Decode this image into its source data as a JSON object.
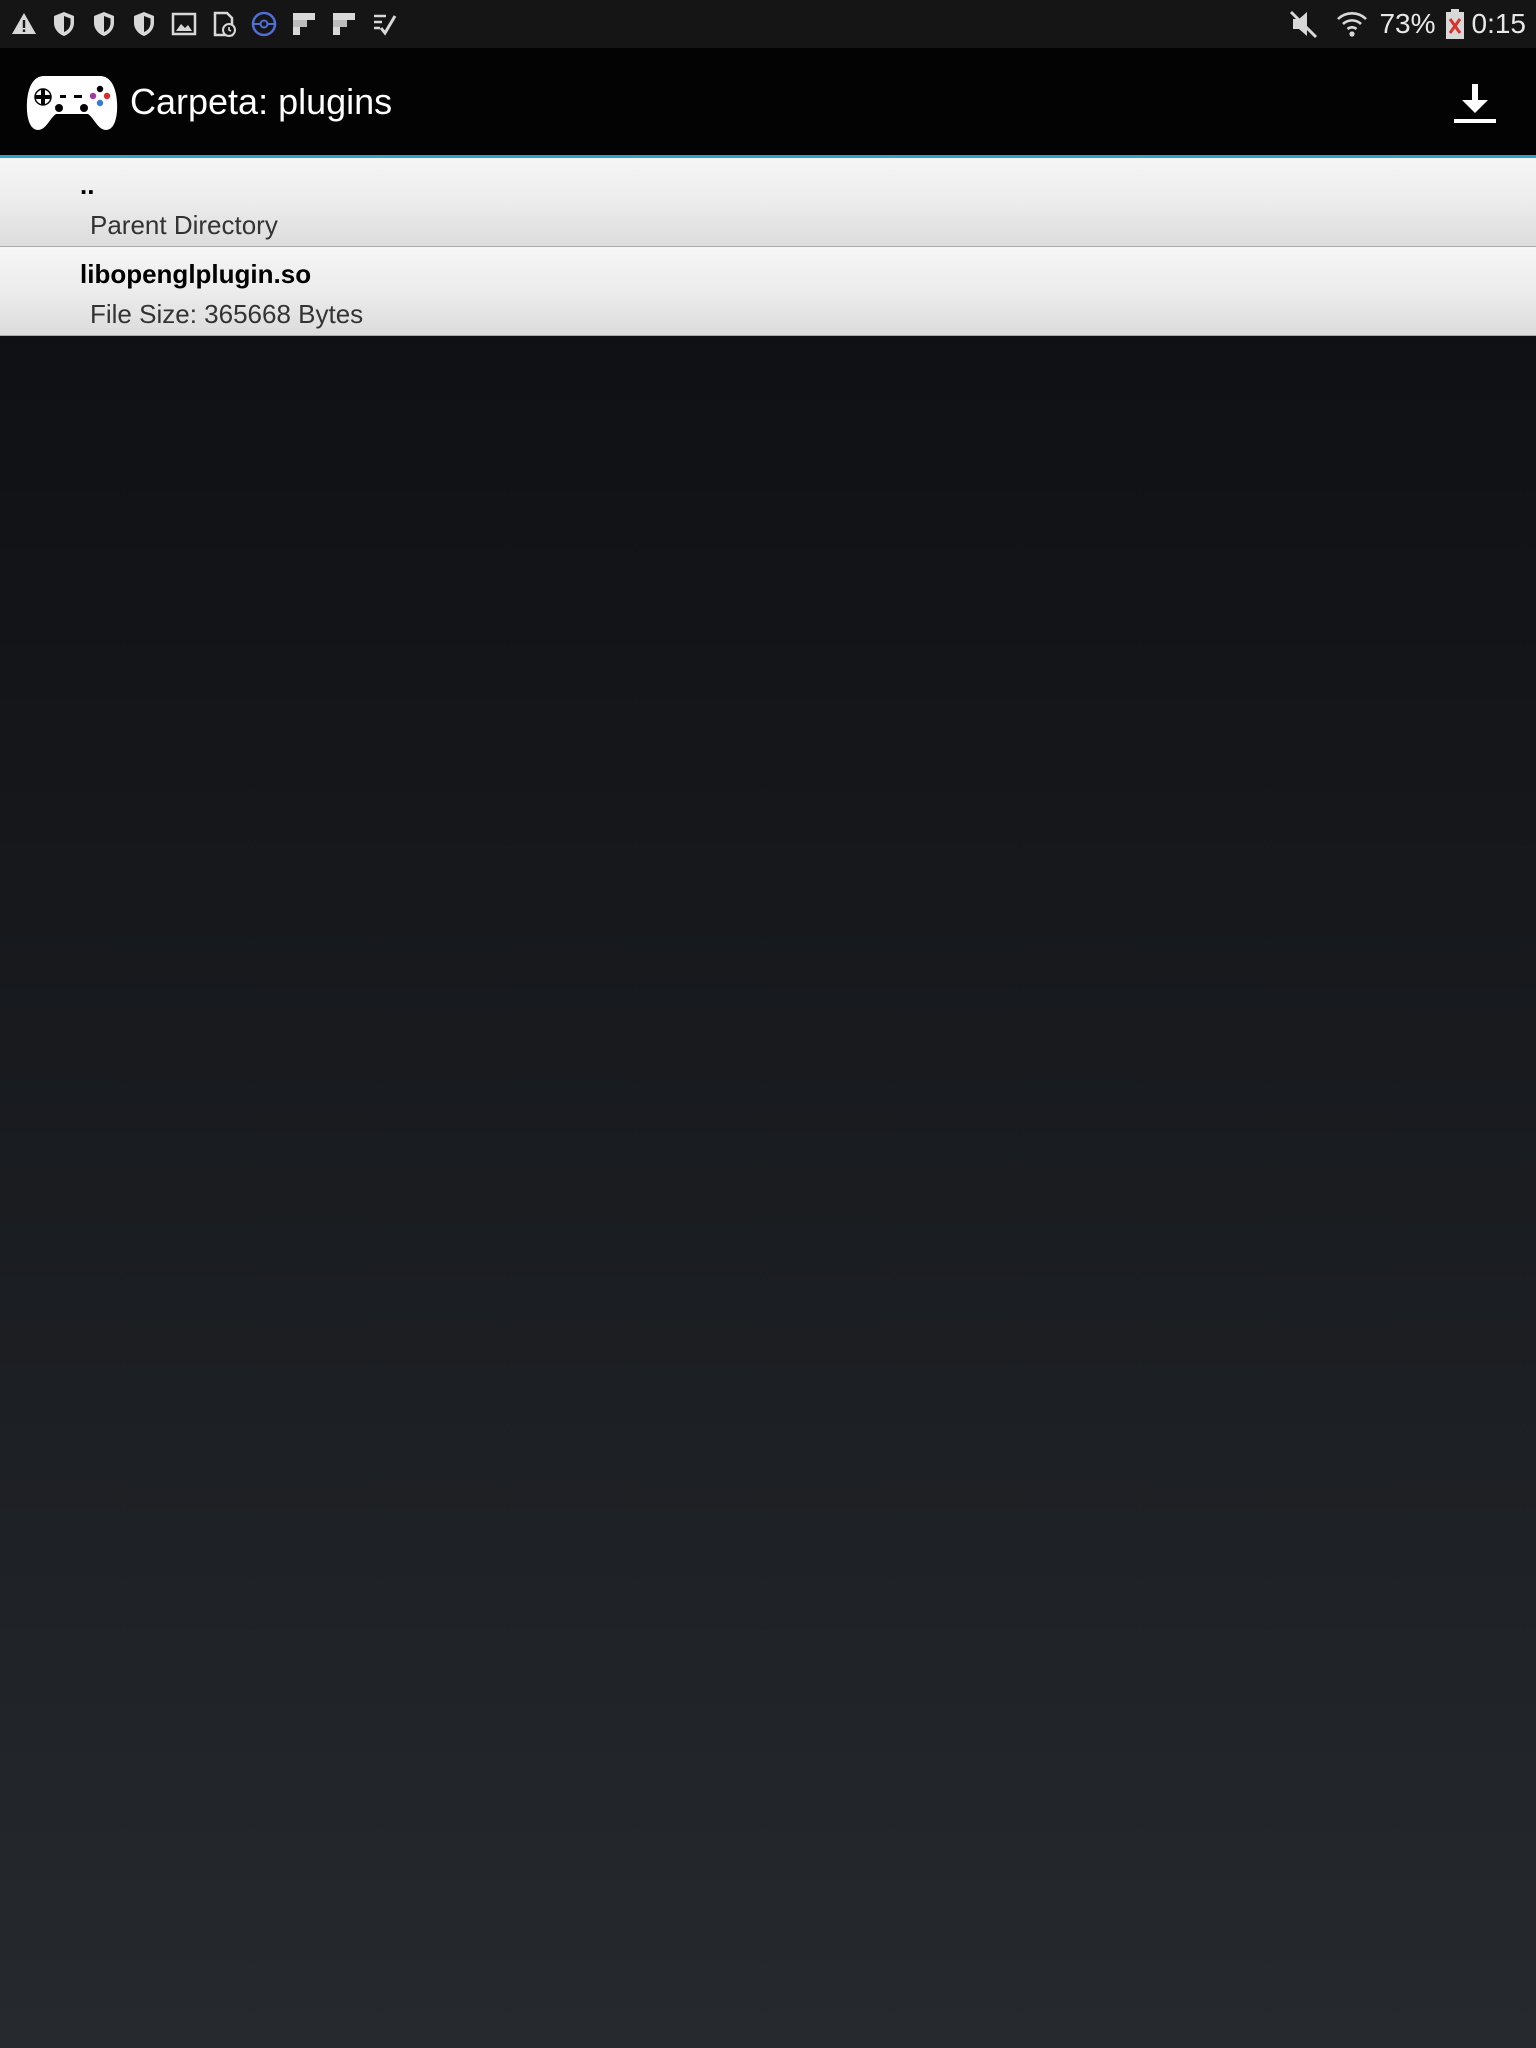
{
  "status_bar": {
    "left_icons": [
      "warning-icon",
      "shield-icon",
      "shield-icon",
      "shield-icon",
      "image-icon",
      "sim-clock-icon",
      "circle-app-icon",
      "flipboard-icon",
      "flipboard-icon",
      "checklist-icon"
    ],
    "mute_icon": "mute-icon",
    "wifi_icon": "wifi-icon",
    "battery_percent": "73%",
    "battery_icon": "battery-icon",
    "time": "0:15"
  },
  "action_bar": {
    "app_icon": "gamepad-icon",
    "title": "Carpeta: plugins",
    "download_icon": "download-icon",
    "accent_color": "#33a0c8"
  },
  "file_list": {
    "items": [
      {
        "name": "..",
        "description": "Parent Directory"
      },
      {
        "name": "libopenglplugin.so",
        "description": "File Size: 365668 Bytes"
      }
    ]
  }
}
